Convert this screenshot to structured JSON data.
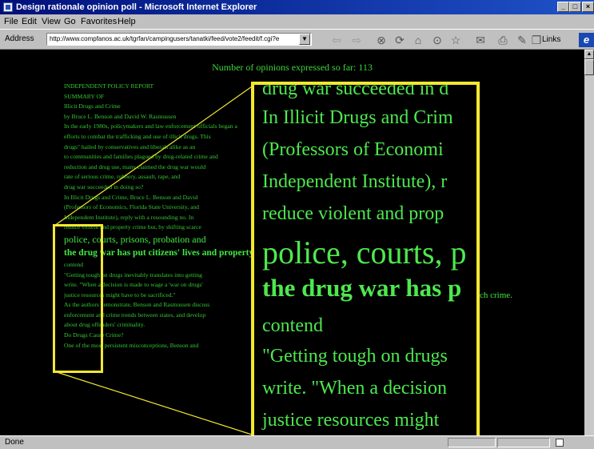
{
  "window": {
    "title": "Design rationale opinion poll - Microsoft Internet Explorer"
  },
  "menu": [
    "File",
    "Edit",
    "View",
    "Go",
    "Favorites",
    "Help"
  ],
  "address": {
    "label": "Address",
    "url": "http://www.compfanos.ac.uk/tgrfan/campingusers/tanatki/feed/vote2/feedit/f.cgi?e"
  },
  "toolbar": {
    "links_label": "Links"
  },
  "page": {
    "counter": "Number of opinions expressed so far: 113",
    "side_text": "ch crime.",
    "lines": [
      "INDEPENDENT POLICY REPORT",
      "SUMMARY OF",
      "Illicit Drugs and Crime",
      "by Bruce L. Benson and David W. Rasmussen",
      "In the early 1980s, policymakers and law enforcement officials began a",
      "efforts to combat the trafficking and use of illicit drugs. This",
      "drugs\" hailed by conservatives and liberals alike as an",
      "to communities and families plagued by drug-related crime and",
      "reduction and drug use, many claimed the drug war would",
      "rate of serious crime, robbery, assault, rape, and",
      "drug war succeeded in doing so?",
      "In Illicit Drugs and Crime, Bruce L. Benson and David",
      "(Professors of Economics, Florida State University, and",
      "Independent Institute), reply with a resounding no. In",
      "reduce violent and property crime but, by shifting scarce",
      "police, courts, prisons, probation and",
      "the drug war has put citizens' lives and property",
      "contend",
      "\"Getting tough on drugs inevitably translates into getting",
      "write. \"When a decision is made to wage a 'war on drugs'",
      "justice resources might have to be sacrificed.\"",
      "As the authors demonstrate, Benson and Rasmussen discuss",
      "enforcement and crime trends between states, and develop",
      "about drug offenders' criminality.",
      "Do Drugs Cause Crime?",
      "One of the most persistent misconceptions, Benson and"
    ]
  },
  "magnifier": {
    "lines": [
      "drug war succeeded in d",
      "In Illicit Drugs and Crim",
      "(Professors of Economi",
      "Independent Institute), r",
      "reduce violent and prop",
      "police, courts, p",
      "the drug war has p",
      "contend",
      "\"Getting tough on drugs",
      "write. \"When a decision",
      "justice resources might"
    ]
  },
  "status": {
    "text": "Done"
  },
  "colors": {
    "page_text": "#3fd43f",
    "highlight": "#f2e830",
    "background": "#000000",
    "titlebar": "#00107a"
  }
}
